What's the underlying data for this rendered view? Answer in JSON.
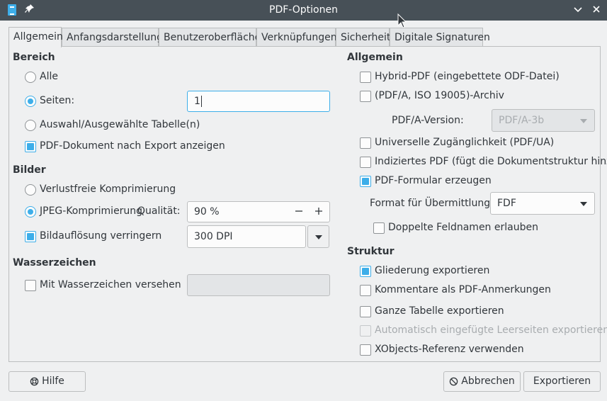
{
  "window": {
    "title": "PDF-Optionen"
  },
  "tabs": [
    "Allgemein",
    "Anfangsdarstellung",
    "Benutzeroberfläche",
    "Verknüpfungen",
    "Sicherheit",
    "Digitale Signaturen"
  ],
  "bereich": {
    "heading": "Bereich",
    "all_label": "Alle",
    "pages_label": "Seiten:",
    "pages_value": "1",
    "selection_label": "Auswahl/Ausgewählte Tabelle(n)",
    "view_after_export_label": "PDF-Dokument nach Export anzeigen"
  },
  "bilder": {
    "heading": "Bilder",
    "lossless_label": "Verlustfreie Komprimierung",
    "jpeg_label": "JPEG-Komprimierung",
    "quality_label": "Qualität:",
    "quality_value": "90 %",
    "reduce_label": "Bildauflösung verringern",
    "dpi_value": "300 DPI"
  },
  "wasserzeichen": {
    "heading": "Wasserzeichen",
    "sign_label": "Mit Wasserzeichen versehen"
  },
  "allgemein": {
    "heading": "Allgemein",
    "hybrid_label": "Hybrid-PDF (eingebettete ODF-Datei)",
    "pdfa_label": "(PDF/A, ISO 19005)-Archiv",
    "pdfa_version_label": "PDF/A-Version:",
    "pdfa_version_value": "PDF/A-3b",
    "ua_label": "Universelle Zugänglichkeit (PDF/UA)",
    "tagged_label": "Indiziertes PDF (fügt die Dokumentstruktur hinzu)",
    "form_label": "PDF-Formular erzeugen",
    "submit_format_label": "Format für Übermittlung:",
    "submit_format_value": "FDF",
    "duplicate_names_label": "Doppelte Feldnamen erlauben"
  },
  "struktur": {
    "heading": "Struktur",
    "outline_label": "Gliederung exportieren",
    "comments_label": "Kommentare als PDF-Anmerkungen",
    "whole_sheet_label": "Ganze Tabelle exportieren",
    "blank_pages_label": "Automatisch eingefügte Leerseiten exportieren",
    "xobjects_label": "XObjects-Referenz verwenden"
  },
  "buttons": {
    "help": "Hilfe",
    "cancel": "Abbrechen",
    "export": "Exportieren"
  },
  "colors": {
    "accent": "#3daee9",
    "titlebar": "#475057",
    "window_bg": "#eff0f1"
  },
  "icons": [
    "calc-app-icon",
    "pin-icon",
    "chevron-down-icon",
    "close-icon",
    "lifebuoy-icon",
    "cancel-icon"
  ]
}
